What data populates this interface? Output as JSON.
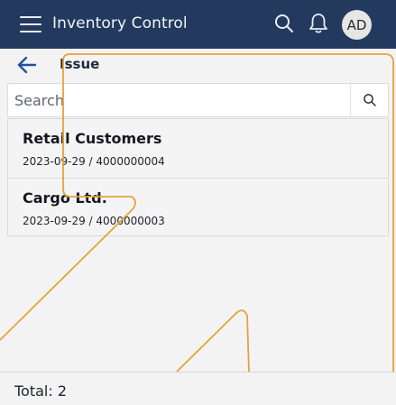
{
  "header": {
    "app_title": "Inventory Control",
    "avatar_initials": "AD",
    "background_color": "#233a5e"
  },
  "subheader": {
    "page_title": "Issue",
    "back_icon": "arrow-left-icon",
    "back_icon_color": "#2a4e9b"
  },
  "search": {
    "placeholder": "Search",
    "value": "",
    "icon": "search-icon"
  },
  "list": {
    "items": [
      {
        "name": "Retail Customers",
        "meta": "2023-09-29 / 4000000004"
      },
      {
        "name": "Cargo Ltd.",
        "meta": "2023-09-29 / 4000000003"
      }
    ]
  },
  "footer": {
    "total_label": "Total: 2"
  },
  "accent_colors": {
    "decorative_line": "#e8a13c"
  }
}
